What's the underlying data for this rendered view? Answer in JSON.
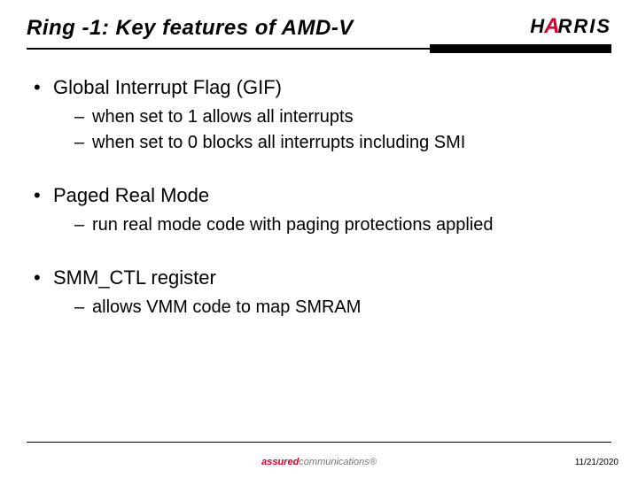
{
  "header": {
    "title": "Ring -1: Key features of AMD-V",
    "logo_left": "H",
    "logo_right": "RRIS",
    "logo_a": "A"
  },
  "bullets": [
    {
      "top": "Global Interrupt Flag (GIF)",
      "subs": [
        "when set to 1 allows all interrupts",
        "when set to 0 blocks all interrupts including SMI"
      ]
    },
    {
      "top": "Paged Real Mode",
      "subs": [
        "run real mode code with paging protections applied"
      ]
    },
    {
      "top": "SMM_CTL register",
      "subs": [
        "allows VMM code to map SMRAM"
      ]
    }
  ],
  "footer": {
    "brand_prefix": "assured",
    "brand_suffix": "communications",
    "reg": "®",
    "date": "11/21/2020"
  }
}
